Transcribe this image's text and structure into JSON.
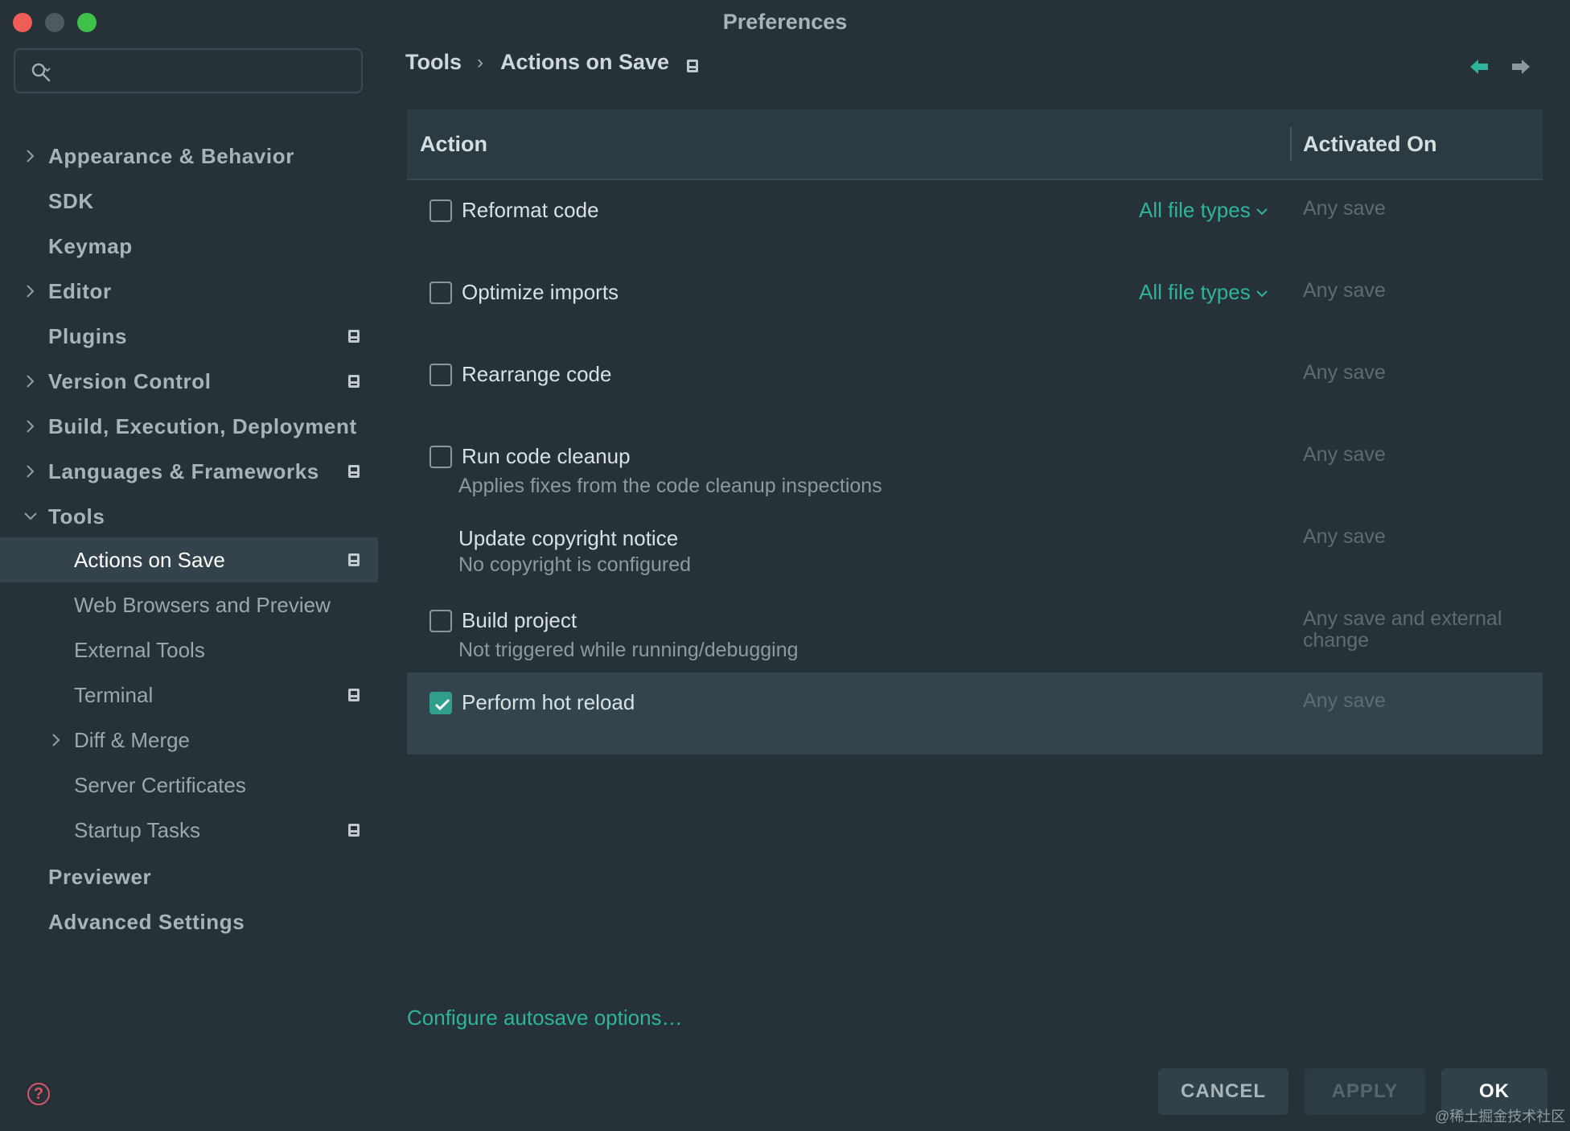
{
  "window": {
    "title": "Preferences"
  },
  "sidebar": {
    "search": {
      "placeholder": ""
    },
    "items": [
      {
        "label": "Appearance & Behavior",
        "expandable": true
      },
      {
        "label": "SDK"
      },
      {
        "label": "Keymap"
      },
      {
        "label": "Editor",
        "expandable": true
      },
      {
        "label": "Plugins",
        "project_icon": true
      },
      {
        "label": "Version Control",
        "expandable": true,
        "project_icon": true
      },
      {
        "label": "Build, Execution, Deployment",
        "expandable": true
      },
      {
        "label": "Languages & Frameworks",
        "expandable": true,
        "project_icon": true
      },
      {
        "label": "Tools",
        "expanded": true
      },
      {
        "label": "Actions on Save",
        "selected": true,
        "project_icon": true
      },
      {
        "label": "Web Browsers and Preview"
      },
      {
        "label": "External Tools"
      },
      {
        "label": "Terminal",
        "project_icon": true
      },
      {
        "label": "Diff & Merge",
        "expandable": true
      },
      {
        "label": "Server Certificates"
      },
      {
        "label": "Startup Tasks",
        "project_icon": true
      },
      {
        "label": "Previewer"
      },
      {
        "label": "Advanced Settings"
      }
    ]
  },
  "breadcrumb": {
    "parent": "Tools",
    "separator": "›",
    "current": "Actions on Save"
  },
  "table": {
    "columns": {
      "action": "Action",
      "activated_on": "Activated On"
    },
    "rows": [
      {
        "title": "Reformat code",
        "checked": false,
        "file_types": "All file types",
        "activated_on": "Any save"
      },
      {
        "title": "Optimize imports",
        "checked": false,
        "file_types": "All file types",
        "activated_on": "Any save"
      },
      {
        "title": "Rearrange code",
        "checked": false,
        "activated_on": "Any save"
      },
      {
        "title": "Run code cleanup",
        "checked": false,
        "subtitle": "Applies fixes from the code cleanup inspections",
        "activated_on": "Any save"
      },
      {
        "title": "Update copyright notice",
        "subtitle": "No copyright is configured",
        "activated_on": "Any save"
      },
      {
        "title": "Build project",
        "checked": false,
        "subtitle": "Not triggered while running/debugging",
        "activated_on": "Any save and external change"
      },
      {
        "title": "Perform hot reload",
        "checked": true,
        "activated_on": "Any save"
      }
    ]
  },
  "links": {
    "autosave": "Configure autosave options…"
  },
  "buttons": {
    "cancel": "CANCEL",
    "apply": "APPLY",
    "ok": "OK"
  },
  "help": {
    "glyph": "?"
  },
  "watermark": "@稀土掘金技术社区",
  "colors": {
    "accent": "#2eb39c",
    "background": "#263238",
    "selected_row": "#34444c",
    "close": "#ee5e57",
    "maximize": "#3dc14a"
  }
}
